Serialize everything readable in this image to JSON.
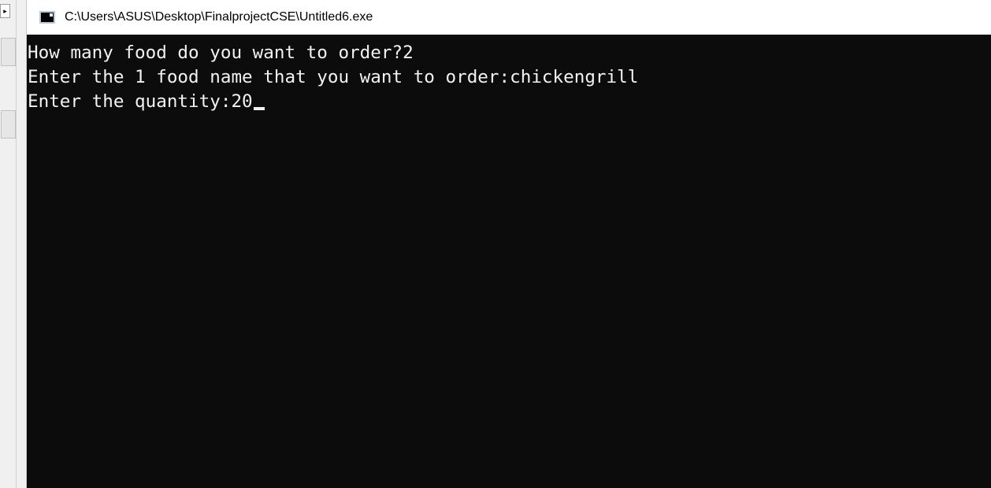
{
  "window": {
    "title": "C:\\Users\\ASUS\\Desktop\\FinalprojectCSE\\Untitled6.exe",
    "icon": "console-app-icon"
  },
  "console": {
    "lines": [
      "How many food do you want to order?2",
      "Enter the 1 food name that you want to order:chickengrill",
      "Enter the quantity:20"
    ],
    "background": "#0c0c0c",
    "foreground": "#f2f2f2"
  },
  "background_window": {
    "arrow": "▸"
  }
}
